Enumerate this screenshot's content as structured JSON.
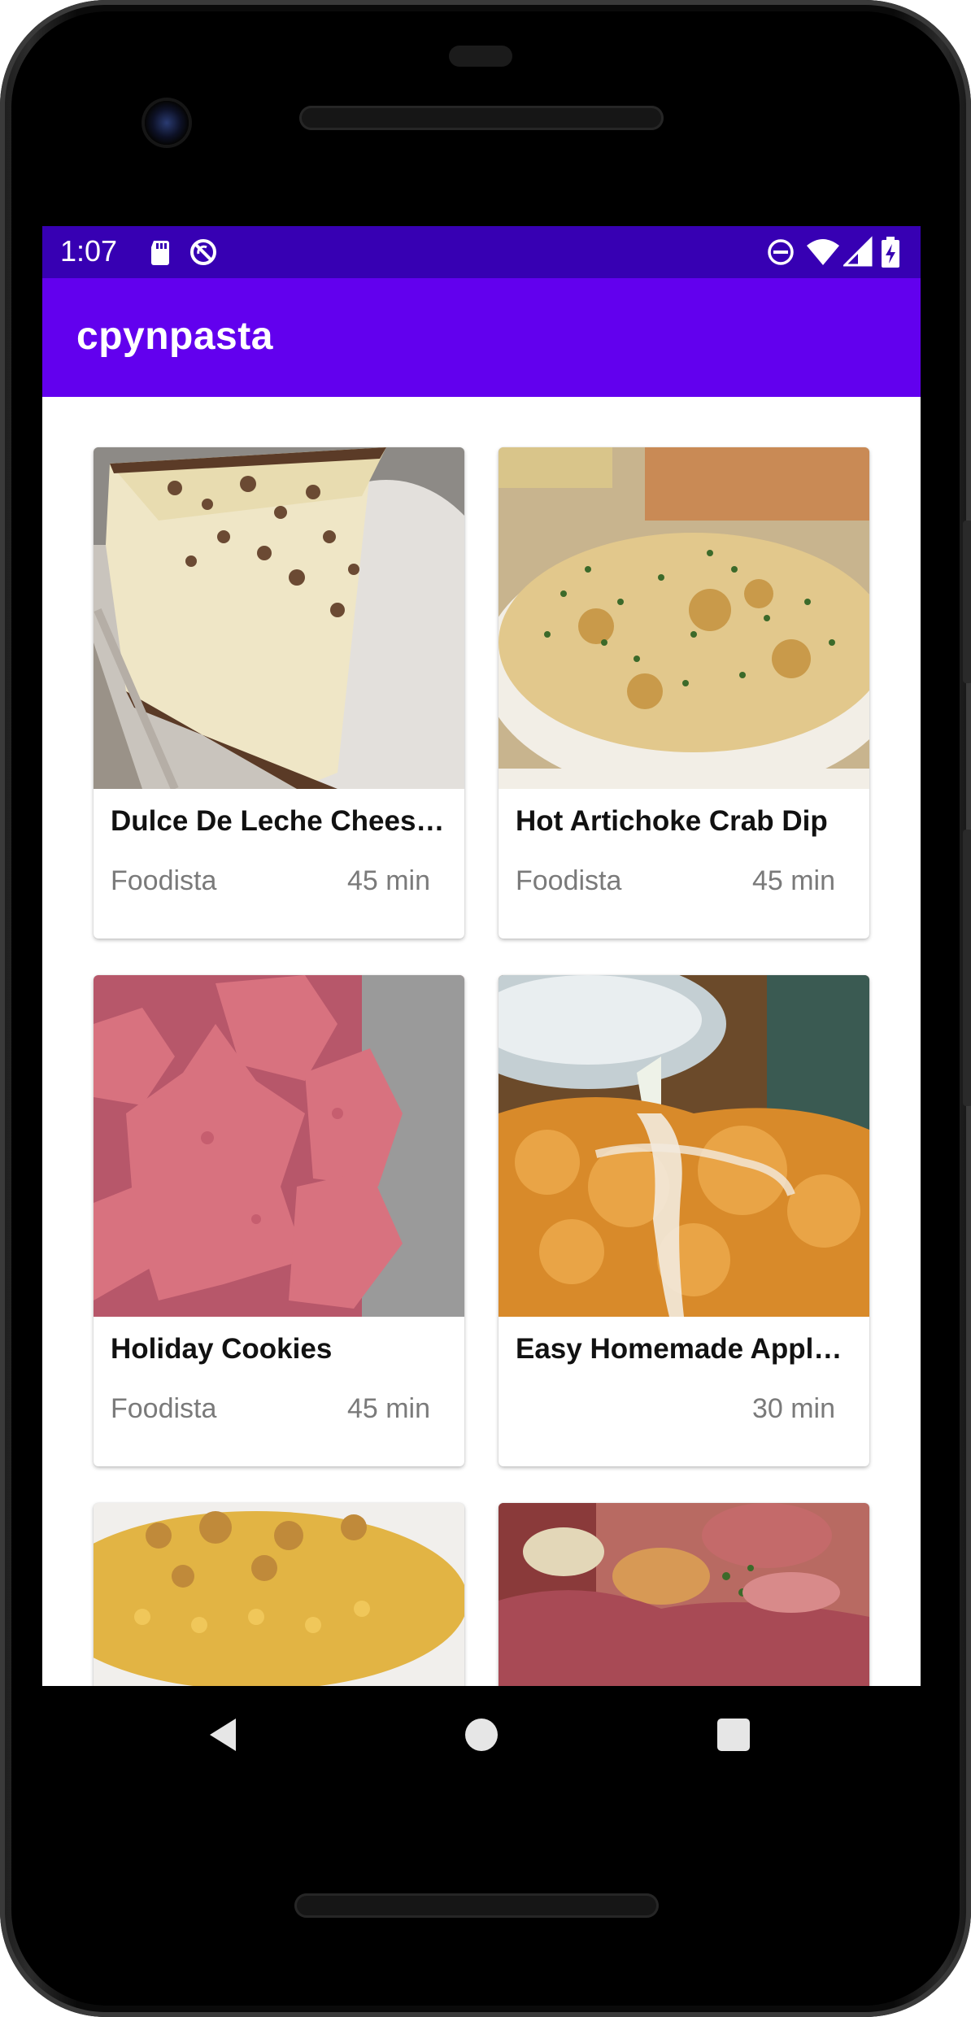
{
  "status_bar": {
    "time": "1:07",
    "left_icons": [
      "sd-card-icon",
      "no-sync-icon"
    ],
    "right_icons": [
      "do-not-disturb-icon",
      "wifi-icon",
      "signal-icon",
      "battery-charging-icon"
    ],
    "color": "#3700b3"
  },
  "app_bar": {
    "title": "cpynpasta",
    "color": "#6200ee"
  },
  "recipes": [
    {
      "title": "Dulce De Leche Chees…",
      "source": "Foodista",
      "time": "45 min",
      "image": "cheesecake-slice"
    },
    {
      "title": "Hot Artichoke Crab Dip",
      "source": "Foodista",
      "time": "45 min",
      "image": "baked-dip"
    },
    {
      "title": "Holiday Cookies",
      "source": "Foodista",
      "time": "45 min",
      "image": "pink-cookies"
    },
    {
      "title": "Easy Homemade Apple…",
      "source": "",
      "time": "30 min",
      "image": "glazed-fritter"
    },
    {
      "title": "",
      "source": "",
      "time": "",
      "image": "mac-and-cheese"
    },
    {
      "title": "",
      "source": "",
      "time": "",
      "image": "corned-beef"
    }
  ],
  "nav_bar": {
    "icons": [
      "back-icon",
      "home-icon",
      "recents-icon"
    ]
  }
}
